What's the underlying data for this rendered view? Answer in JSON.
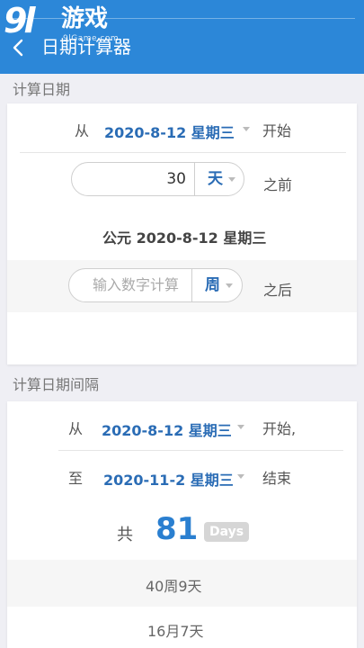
{
  "header": {
    "logo_mark": "9l",
    "logo_text": "游戏",
    "logo_url": "9lGame.com",
    "title": "日期计算器"
  },
  "calc_date": {
    "section_label": "计算日期",
    "from_label": "从",
    "start_date": "2020-8-12 星期三",
    "start_suffix": "开始",
    "days_value": "30",
    "days_unit": "天",
    "before_label": "之前",
    "result": "公元 2020-8-12  星期三",
    "input_placeholder": "输入数字计算",
    "week_unit": "周",
    "after_label": "之后"
  },
  "calc_interval": {
    "section_label": "计算日期间隔",
    "from_label": "从",
    "start_date": "2020-8-12 星期三",
    "start_suffix": "开始,",
    "to_label": "至",
    "end_date": "2020-11-2 星期三",
    "end_suffix": "结束",
    "total_label": "共",
    "total_days": "81",
    "days_badge": "Days",
    "weeks_days": "40周9天",
    "months_days": "16月7天"
  }
}
